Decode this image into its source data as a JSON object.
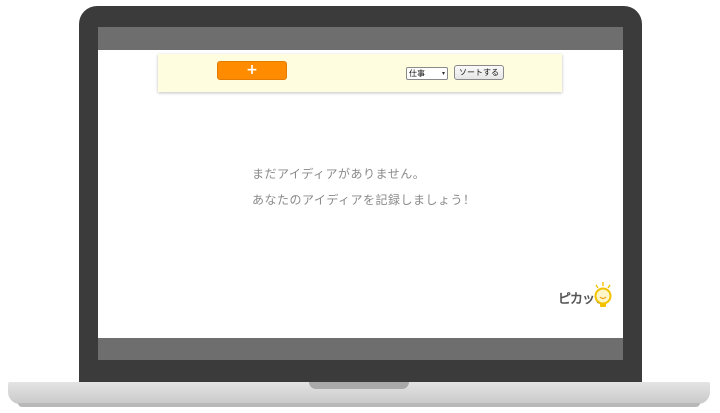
{
  "toolbar": {
    "add_label": "+",
    "category_selected": "仕事",
    "sort_label": "ソートする"
  },
  "empty_state": {
    "line1": "まだアイディアがありません。",
    "line2": "あなたのアイディアを記録しましょう！"
  },
  "logo": {
    "text": "ピカッと"
  },
  "colors": {
    "accent": "#ff8c00",
    "toolbar_bg": "#fffde0",
    "bezel": "#3b3b3b",
    "text_muted": "#8a8a8a"
  },
  "icons": {
    "logo": "lightbulb-icon",
    "select": "chevron-down-icon"
  }
}
